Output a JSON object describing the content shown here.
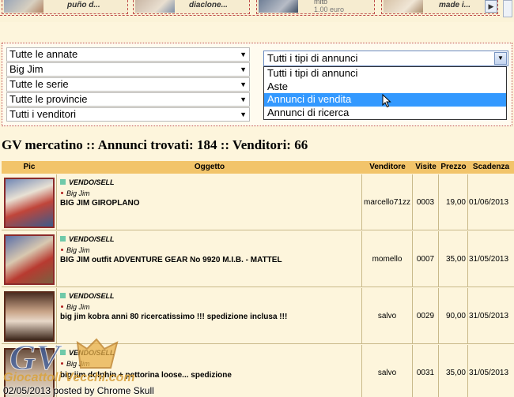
{
  "carousel": {
    "items": [
      {
        "caption": "puño d..."
      },
      {
        "caption": "diaclone..."
      },
      {
        "caption_top": "mitb",
        "caption": "1.00 euro"
      },
      {
        "caption": "made i..."
      }
    ],
    "scroll_right": "▶"
  },
  "filters": {
    "annate": "Tutte le annate",
    "serie_first": "Big Jim",
    "serie": "Tutte le serie",
    "province": "Tutte le provincie",
    "venditori": "Tutti i venditori",
    "tipi_selected": "Tutti i tipi di annunci",
    "tipi_options": [
      "Tutti i tipi di annunci",
      "Aste",
      "Annunci di vendita",
      "Annunci di ricerca"
    ]
  },
  "heading": "GV mercatino :: Annunci trovati: 184 :: Venditori: 66",
  "table": {
    "headers": {
      "pic": "Pic",
      "oggetto": "Oggetto",
      "venditore": "Venditore",
      "visite": "Visite",
      "prezzo": "Prezzo",
      "scadenza": "Scadenza"
    },
    "rows": [
      {
        "tag": "VENDO/SELL",
        "category": "Big Jim",
        "title": "BIG JIM GIROPLANO",
        "venditore": "marcello71zz",
        "visite": "0003",
        "prezzo": "19,00",
        "scadenza": "01/06/2013"
      },
      {
        "tag": "VENDO/SELL",
        "category": "Big Jim",
        "title": "BIG JIM outfit ADVENTURE GEAR No 9920 M.I.B. - MATTEL",
        "venditore": "momello",
        "visite": "0007",
        "prezzo": "35,00",
        "scadenza": "31/05/2013"
      },
      {
        "tag": "VENDO/SELL",
        "category": "Big Jim",
        "title": "big jim kobra anni 80 ricercatissimo !!! spedizione inclusa !!!",
        "venditore": "salvo",
        "visite": "0029",
        "prezzo": "90,00",
        "scadenza": "31/05/2013"
      },
      {
        "tag": "VENDO/SELL",
        "category": "Big Jim",
        "title": "big jim dolphin + pettorina loose... spedizione",
        "venditore": "salvo",
        "visite": "0031",
        "prezzo": "35,00",
        "scadenza": "31/05/2013"
      }
    ]
  },
  "watermark": {
    "logo": "GV",
    "text": "Giocattoli Vecchi.com"
  },
  "footer": "02/05/2013 posted by Chrome Skull"
}
